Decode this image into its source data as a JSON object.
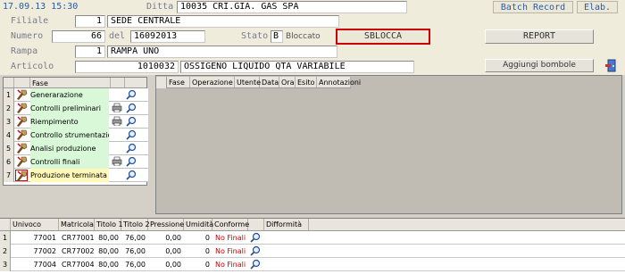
{
  "header": {
    "datetime": "17.09.13 15:30",
    "ditta_label": "Ditta",
    "ditta_code": "10035",
    "ditta_name": "CRI.GIA. GAS SPA",
    "batch_record": "Batch Record",
    "elab": "Elab.",
    "filiale_label": "Filiale",
    "filiale_code": "1",
    "filiale_name": "SEDE CENTRALE",
    "numero_label": "Numero",
    "numero_value": "66",
    "del_label": "del",
    "del_value": "16092013",
    "stato_label": "Stato",
    "stato_code": "B",
    "stato_text": "Bloccato",
    "sblocca": "SBLOCCA",
    "report": "REPORT",
    "rampa_label": "Rampa",
    "rampa_code": "1",
    "rampa_name": "RAMPA UNO",
    "articolo_label": "Articolo",
    "articolo_code": "1010032",
    "articolo_name": "OSSIGENO LIQUIDO QTA VARIABILE",
    "aggiungi": "Aggiungi bombole"
  },
  "phases": {
    "header": "Fase",
    "rows": [
      {
        "num": "1",
        "label": "Generarazione",
        "color": "#d8f8d8",
        "extra": ""
      },
      {
        "num": "2",
        "label": "Controlli preliminari",
        "color": "#d8f8d8",
        "extra": "printer"
      },
      {
        "num": "3",
        "label": "Riempimento",
        "color": "#d8f8d8",
        "extra": "printer"
      },
      {
        "num": "4",
        "label": "Controllo strumentazione",
        "color": "#d8f8d8",
        "extra": ""
      },
      {
        "num": "5",
        "label": "Analisi produzione",
        "color": "#d8f8d8",
        "extra": ""
      },
      {
        "num": "6",
        "label": "Controlli finali",
        "color": "#d8f8d8",
        "extra": "printer"
      },
      {
        "num": "7",
        "label": "Produzione terminata",
        "color": "#fff8b8",
        "extra": ""
      }
    ]
  },
  "ops": {
    "columns": [
      "Fase",
      "Operazione",
      "Utente",
      "Data",
      "Ora",
      "Esito",
      "Annotazioni"
    ]
  },
  "bottles": {
    "columns": [
      "Univoco",
      "Matricola",
      "Titolo 1",
      "Titolo 2",
      "Pressione",
      "Umidità",
      "Conforme",
      "",
      "Difformità"
    ],
    "rows": [
      {
        "num": "1",
        "univoco": "77001",
        "matricola": "CR77001",
        "t1": "80,00",
        "t2": "76,00",
        "pressione": "0,00",
        "umidita": "0",
        "conforme": "No Finali"
      },
      {
        "num": "2",
        "univoco": "77002",
        "matricola": "CR77002",
        "t1": "80,00",
        "t2": "76,00",
        "pressione": "0,00",
        "umidita": "0",
        "conforme": "No Finali"
      },
      {
        "num": "3",
        "univoco": "77004",
        "matricola": "CR77004",
        "t1": "80,00",
        "t2": "76,00",
        "pressione": "0,00",
        "umidita": "0",
        "conforme": "No Finali"
      }
    ]
  },
  "colors": {
    "accent": "#2a5aa8",
    "alert": "#cc0000",
    "phase_done": "#d8f8d8",
    "phase_current": "#fff8b8"
  },
  "icons": {
    "phase": "hand-tool-icon",
    "view": "magnifier-icon",
    "print": "printer-icon",
    "exit": "exit-door-icon"
  }
}
